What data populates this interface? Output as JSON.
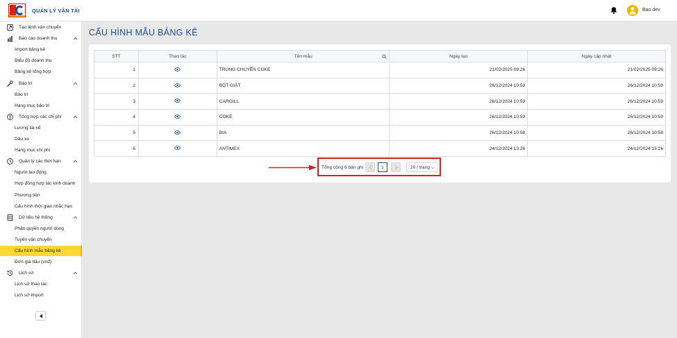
{
  "header": {
    "app_title": "QUẢN LÝ VẬN TẢI",
    "user_name": "Bao dev",
    "brand_color": "#1a4d9c"
  },
  "sidebar": {
    "rows": [
      {
        "kind": "group",
        "label": "Tạo lệnh vận chuyển",
        "icon": "create-order-icon",
        "expanded": false
      },
      {
        "kind": "group",
        "label": "Báo cáo doanh thu",
        "icon": "revenue-report-icon",
        "expanded": true
      },
      {
        "kind": "sub",
        "label": "Import bảng kê"
      },
      {
        "kind": "sub",
        "label": "Biểu đồ doanh thu"
      },
      {
        "kind": "sub",
        "label": "Bảng kê tổng hợp"
      },
      {
        "kind": "group",
        "label": "Bảo trì",
        "icon": "wrench-icon",
        "expanded": true
      },
      {
        "kind": "sub",
        "label": "Bảo trì"
      },
      {
        "kind": "sub",
        "label": "Hạng mục bảo trì"
      },
      {
        "kind": "group",
        "label": "Tổng hợp các chi phí",
        "icon": "dollar-icon",
        "expanded": true
      },
      {
        "kind": "sub",
        "label": "Lương tài xế"
      },
      {
        "kind": "sub",
        "label": "Dầu xe"
      },
      {
        "kind": "sub",
        "label": "Hạng mục chi phí"
      },
      {
        "kind": "group",
        "label": "Quản lý các thời hạn",
        "icon": "clock-icon",
        "expanded": true
      },
      {
        "kind": "sub",
        "label": "Người lao động"
      },
      {
        "kind": "sub",
        "label": "Hợp đồng hợp tác kinh doanh"
      },
      {
        "kind": "sub",
        "label": "Phương tiện"
      },
      {
        "kind": "sub",
        "label": "Cấu hình thời gian nhắc hạn"
      },
      {
        "kind": "group",
        "label": "Dữ liệu hệ thống",
        "icon": "database-icon",
        "expanded": true
      },
      {
        "kind": "sub",
        "label": "Phân quyền người dùng"
      },
      {
        "kind": "sub",
        "label": "Tuyến vận chuyển"
      },
      {
        "kind": "sub",
        "label": "Cấu hình mẫu bảng kê",
        "active": true
      },
      {
        "kind": "sub",
        "label": "Đơn giá dầu (vnđ)"
      },
      {
        "kind": "group",
        "label": "Lịch sử",
        "icon": "history-icon",
        "expanded": true
      },
      {
        "kind": "sub",
        "label": "Lịch sử thao tác"
      },
      {
        "kind": "sub",
        "label": "Lịch sử import"
      }
    ],
    "active_color": "#fdd835"
  },
  "main": {
    "page_title": "CẤU HÌNH MẪU BẢNG KÊ",
    "table": {
      "columns": [
        "STT",
        "Thao tác",
        "Tên mẫu",
        "Ngày tạo",
        "Ngày cập nhật"
      ],
      "rows": [
        {
          "stt": "1",
          "name": "TRUNG CHUYỂN COKE",
          "created": "21/02/2025 09:26",
          "updated": "21/02/2025 09:26"
        },
        {
          "stt": "2",
          "name": "BỘT GIẶT",
          "created": "26/12/2024 10:59",
          "updated": "26/12/2024 10:59"
        },
        {
          "stt": "3",
          "name": "CARGILL",
          "created": "26/12/2024 10:59",
          "updated": "26/12/2024 10:59"
        },
        {
          "stt": "4",
          "name": "COKE",
          "created": "26/12/2024 10:59",
          "updated": "26/12/2024 10:59"
        },
        {
          "stt": "5",
          "name": "BIA",
          "created": "26/12/2024 10:58",
          "updated": "26/12/2024 10:58"
        },
        {
          "stt": "6",
          "name": "ANTIMEX",
          "created": "24/12/2024 13:26",
          "updated": "24/12/2024 13:26"
        }
      ],
      "row_action_icon": "eye-icon"
    },
    "pagination": {
      "total_text": "Tổng cộng 6 bản ghi",
      "current_page": "1",
      "page_size": "20 / trang",
      "highlight_color": "#e01b1b"
    }
  }
}
